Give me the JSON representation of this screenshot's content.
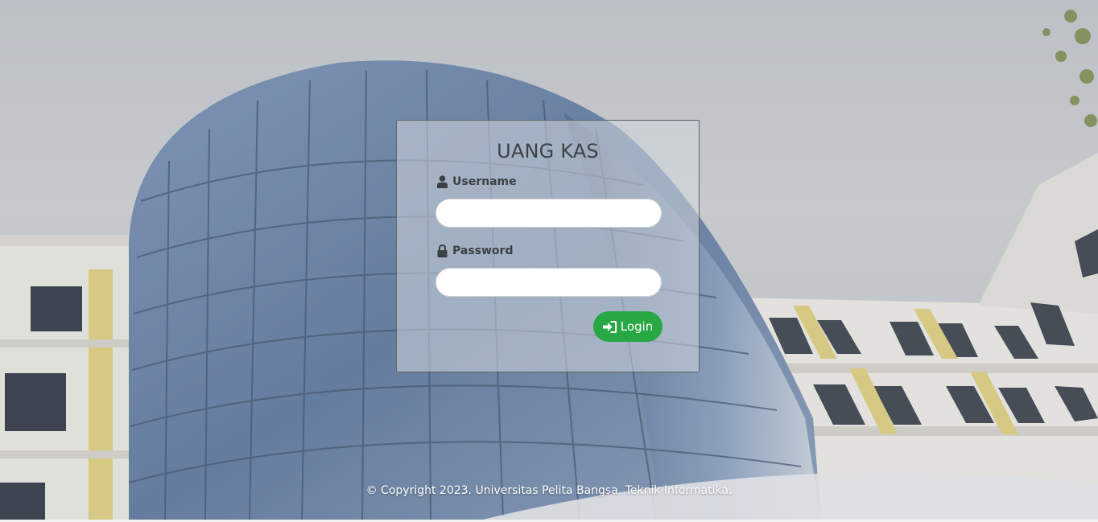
{
  "app": {
    "title": "UANG KAS"
  },
  "form": {
    "username_label": "Username",
    "username_value": "",
    "password_label": "Password",
    "password_value": "",
    "login_label": "Login"
  },
  "icons": {
    "username": "user-icon",
    "password": "lock-icon",
    "login": "sign-in-icon"
  },
  "colors": {
    "login_button": "#28a745",
    "title_text": "#3d4246"
  },
  "footer": {
    "copyright": "© Copyright 2023. Universitas Pelita Bangsa. Teknik Informatika."
  }
}
